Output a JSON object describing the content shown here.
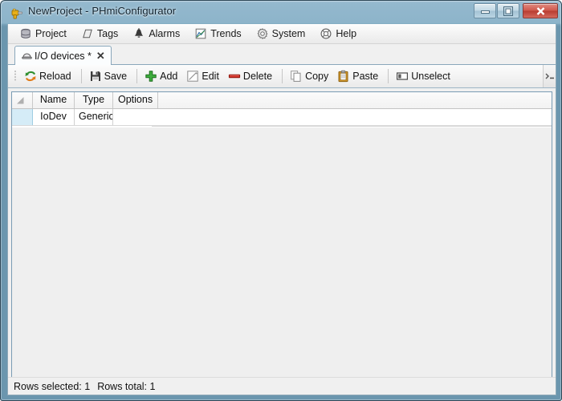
{
  "window": {
    "title": "NewProject - PHmiConfigurator",
    "icon": "drill-tool-icon",
    "controls": {
      "minimize": "minimize-icon",
      "maximize": "maximize-icon",
      "close": "close-icon"
    },
    "colors": {
      "titlebar": "#8ab6cf",
      "frame_border": "#2c4656",
      "close_button": "#c2493c",
      "selection": "#d5ecf7",
      "grid_border": "#7a9cb4"
    }
  },
  "menubar": {
    "items": [
      {
        "label": "Project",
        "icon": "database-icon"
      },
      {
        "label": "Tags",
        "icon": "tag-icon"
      },
      {
        "label": "Alarms",
        "icon": "bell-icon"
      },
      {
        "label": "Trends",
        "icon": "chart-icon"
      },
      {
        "label": "System",
        "icon": "gear-icon"
      },
      {
        "label": "Help",
        "icon": "lifebuoy-icon"
      }
    ]
  },
  "tabs": {
    "active": {
      "label": "I/O devices *",
      "icon": "io-device-icon",
      "close": "✕"
    }
  },
  "toolbar": {
    "buttons": [
      {
        "label": "Reload",
        "icon": "reload-icon"
      },
      {
        "label": "Save",
        "icon": "save-icon"
      },
      {
        "label": "Add",
        "icon": "add-icon"
      },
      {
        "label": "Edit",
        "icon": "edit-icon"
      },
      {
        "label": "Delete",
        "icon": "delete-icon"
      },
      {
        "label": "Copy",
        "icon": "copy-icon"
      },
      {
        "label": "Paste",
        "icon": "paste-icon"
      },
      {
        "label": "Unselect",
        "icon": "unselect-icon"
      }
    ],
    "overflow": "chevron-overflow-icon"
  },
  "grid": {
    "columns": [
      "Name",
      "Type",
      "Options"
    ],
    "rows": [
      {
        "name": "IoDev",
        "type": "Generic",
        "options": ""
      }
    ]
  },
  "statusbar": {
    "rows_selected": "Rows selected: 1",
    "rows_total": "Rows total: 1"
  }
}
